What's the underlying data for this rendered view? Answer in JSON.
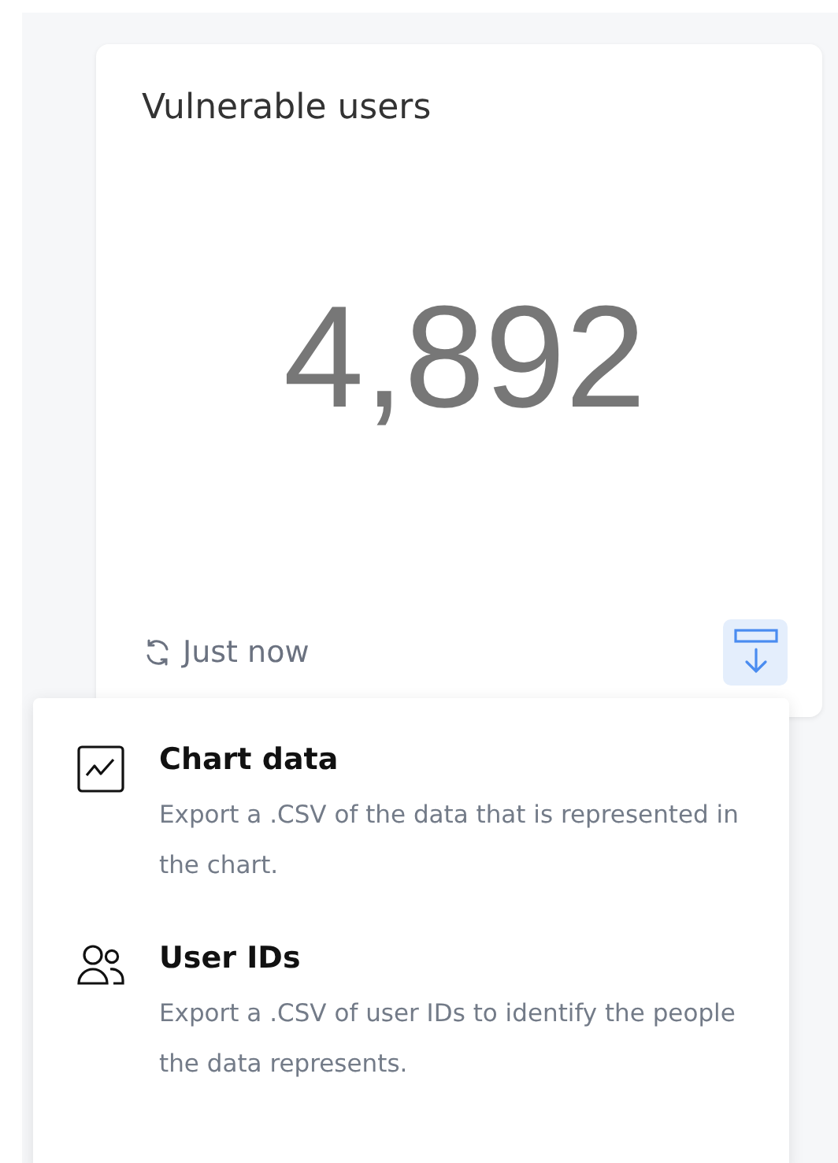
{
  "card": {
    "title": "Vulnerable users",
    "value": "4,892",
    "updated": "Just now"
  },
  "export_menu": {
    "items": [
      {
        "kind": "chart",
        "label": "Chart data",
        "description": "Export a .CSV of the data that is represented in the chart."
      },
      {
        "kind": "users",
        "label": "User IDs",
        "description": "Export a .CSV of user IDs to identify the people the data represents."
      }
    ]
  }
}
